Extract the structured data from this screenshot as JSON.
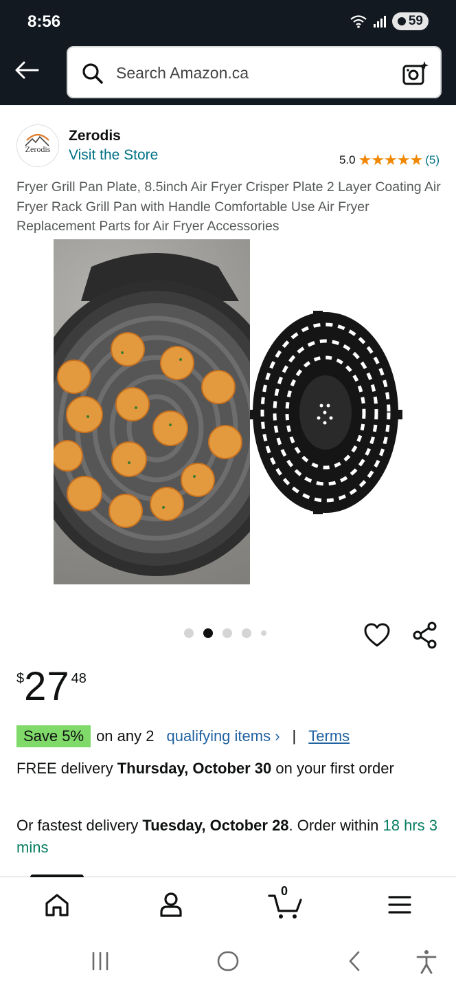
{
  "status_bar": {
    "time": "8:56",
    "battery": "59"
  },
  "search": {
    "placeholder": "Search Amazon.ca"
  },
  "brand": {
    "logo_text": "Zerodis",
    "name": "Zerodis",
    "visit_store": "Visit the Store"
  },
  "rating": {
    "score": "5.0",
    "stars": "★★★★★",
    "count": "(5)",
    "value": 5.0
  },
  "product": {
    "title": "Fryer Grill Pan Plate, 8.5inch Air Fryer Crisper Plate 2 Layer Coating Air Fryer Rack Grill Pan with Handle Comfortable Use Air Fryer Replacement Parts for Air Fryer Accessories"
  },
  "carousel": {
    "total": 5,
    "active_index": 1
  },
  "price": {
    "currency": "$",
    "whole": "27",
    "fraction": "48"
  },
  "promo": {
    "badge": "Save 5%",
    "text": "on any 2",
    "link": "qualifying items ›",
    "separator": "|",
    "terms": "Terms"
  },
  "delivery": {
    "prefix": "FREE delivery ",
    "date": "Thursday, October 30",
    "suffix": " on your first order"
  },
  "fastest": {
    "prefix": "Or fastest delivery ",
    "date": "Tuesday, October 28",
    "middle": ". Order within ",
    "countdown": "18 hrs 3 mins"
  },
  "bottom_nav": {
    "cart_count": "0"
  },
  "colors": {
    "header_bg": "#131921",
    "link": "#007185",
    "star": "#f08804",
    "save_badge": "#7fda69",
    "promo_link": "#2162a1",
    "countdown": "#067d62"
  }
}
